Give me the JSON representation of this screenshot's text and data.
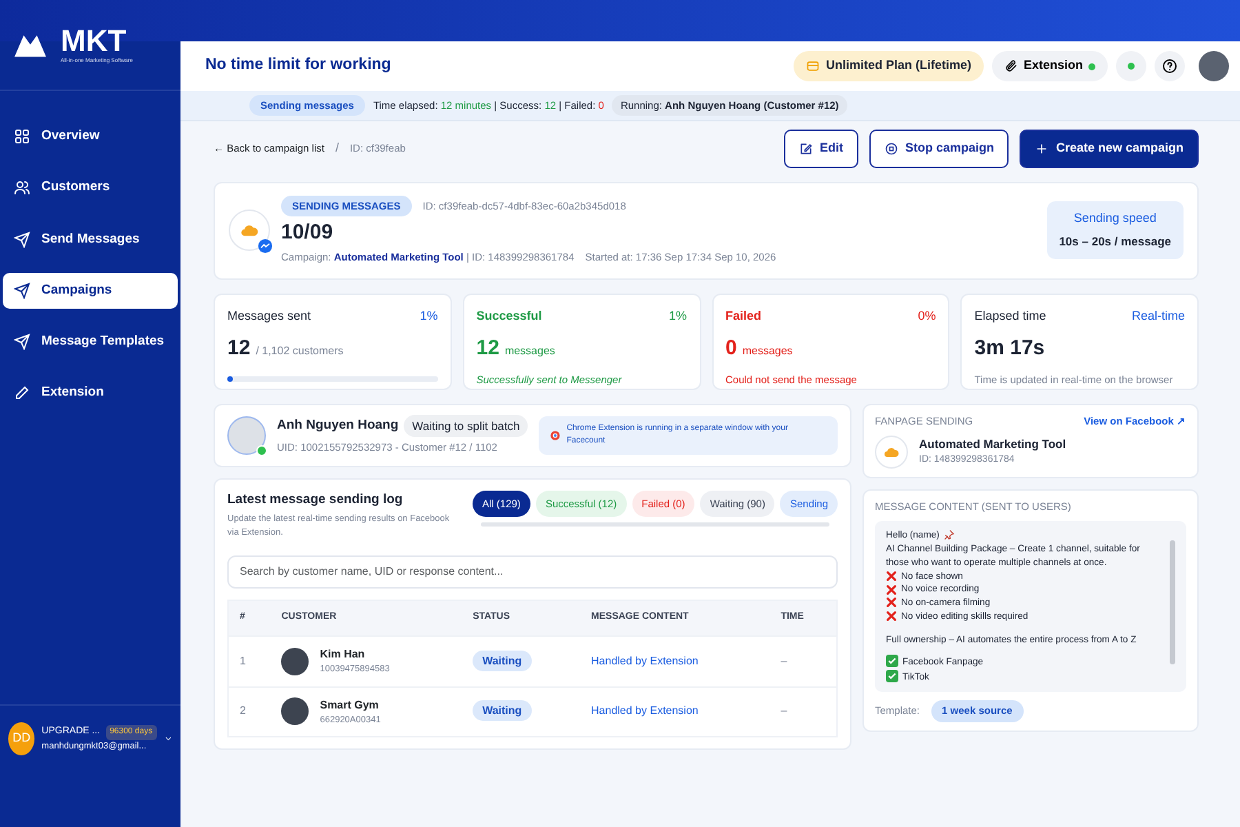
{
  "brand": {
    "name": "MKT",
    "tagline": "All-in-one Marketing Software"
  },
  "sidebar": {
    "items": [
      {
        "label": "Overview",
        "kind": "overview",
        "selected": false
      },
      {
        "label": "Customers",
        "kind": "customers",
        "selected": false
      },
      {
        "label": "Send Messages",
        "kind": "send",
        "selected": false
      },
      {
        "label": "Campaigns",
        "kind": "send",
        "selected": true
      },
      {
        "label": "Message Templates",
        "kind": "send",
        "selected": false
      },
      {
        "label": "Extension",
        "kind": "pen",
        "selected": false
      }
    ],
    "account": {
      "initials": "DD",
      "name": "UPGRADE ...",
      "days": "96300 days",
      "email": "manhdungmkt03@gmail..."
    }
  },
  "header": {
    "title": "No time limit for working",
    "plan": "Unlimited Plan (Lifetime)",
    "extension": "Extension",
    "extension_online": true
  },
  "status_bar": {
    "state": "Sending messages",
    "elapsed_label": "Time elapsed:",
    "elapsed": "12 minutes",
    "success_label": "| Success:",
    "success": "12",
    "failed_label": "| Failed:",
    "failed": "0",
    "running_label": "Running:",
    "running": "Anh Nguyen Hoang (Customer #12)"
  },
  "breadcrumb": {
    "back": "← Back to campaign list",
    "separator": "/",
    "id": "ID:  cf39feab"
  },
  "actions": [
    {
      "label": "Edit",
      "kind": "edit"
    },
    {
      "label": "Stop campaign",
      "kind": "stop"
    },
    {
      "label": "Create new campaign",
      "kind": "create"
    }
  ],
  "campaign": {
    "status": "SENDING MESSAGES",
    "id": "ID:  cf39feab-dc57-4dbf-83ec-60a2b345d018",
    "name": "10/09",
    "campaign_label": "Campaign:",
    "campaign_name": "Automated Marketing Tool",
    "campaign_id": "| ID: 148399298361784",
    "started": "Started at: 17:36   Sep 17:34 Sep 10, 2026",
    "speed_label": "Sending speed",
    "speed": "10s – 20s / message"
  },
  "stats": [
    {
      "kind": "neutral",
      "title": "Messages sent",
      "percent": "1%",
      "value": "12",
      "unit": "/ 1,102 customers",
      "level": 0.01
    },
    {
      "kind": "success",
      "title": "Successful",
      "percent": "1%",
      "value": "12",
      "unit": "messages",
      "note": "Successfully sent to Messenger"
    },
    {
      "kind": "failed",
      "title": "Failed",
      "percent": "0%",
      "value": "0",
      "unit": "messages",
      "note": "Could not send the message"
    },
    {
      "kind": "time",
      "title": "Elapsed time",
      "percent": "Real-time",
      "value": "3m 17s",
      "note": "Time is updated in real-time on the browser"
    }
  ],
  "current_customer": {
    "name": "Anh Nguyen Hoang",
    "state": "Waiting to split batch",
    "online": true,
    "uid": "UID: 1002155792532973 - Customer #12 / 1102",
    "extension_note": "Chrome Extension is running in a separate window with your Facecount"
  },
  "log": {
    "title": "Latest message sending log",
    "subtitle": "Update the latest real-time sending results on Facebook via Extension.",
    "filters": [
      {
        "label": "All (129)",
        "kind": "all",
        "selected": true
      },
      {
        "label": "Successful (12)",
        "kind": "success",
        "selected": false
      },
      {
        "label": "Failed (0)",
        "kind": "failed",
        "selected": false
      },
      {
        "label": "Waiting (90)",
        "kind": "waiting",
        "selected": false
      },
      {
        "label": "Sending",
        "kind": "sending",
        "selected": false
      }
    ],
    "search": {
      "placeholder": "Search by customer name, UID or response content..."
    },
    "table": {
      "columns": [
        "#",
        "CUSTOMER",
        "STATUS",
        "MESSAGE CONTENT",
        "TIME"
      ],
      "rows": [
        {
          "index": "1",
          "name": "Kim Han",
          "uid": "10039475894583",
          "status": "Waiting",
          "content": "Handled by Extension",
          "time": "–"
        },
        {
          "index": "2",
          "name": "Smart Gym",
          "uid": "662920A00341",
          "status": "Waiting",
          "content": "Handled by Extension",
          "time": "–"
        }
      ]
    }
  },
  "fanpage": {
    "title": "FANPAGE SENDING",
    "link": "View on Facebook ↗",
    "name": "Automated Marketing Tool",
    "id": "ID: 148399298361784"
  },
  "message_content": {
    "title": "MESSAGE CONTENT (SENT TO USERS)",
    "lines": [
      {
        "kind": "text",
        "text": "Hello (name)"
      },
      {
        "kind": "text",
        "text": "AI Channel Building Package – Create 1 channel, suitable for those who want to operate multiple channels at once."
      },
      {
        "kind": "cross",
        "text": "No face shown"
      },
      {
        "kind": "cross",
        "text": "No voice recording"
      },
      {
        "kind": "cross",
        "text": "No on-camera filming"
      },
      {
        "kind": "cross",
        "text": "No video editing skills required"
      },
      {
        "kind": "paragraph",
        "text": "Full ownership – AI automates the entire process from A to Z"
      },
      {
        "kind": "check",
        "text": "Facebook Fanpage"
      },
      {
        "kind": "check",
        "text": "TikTok"
      }
    ],
    "template_label": "Template:",
    "template": "1 week source"
  }
}
